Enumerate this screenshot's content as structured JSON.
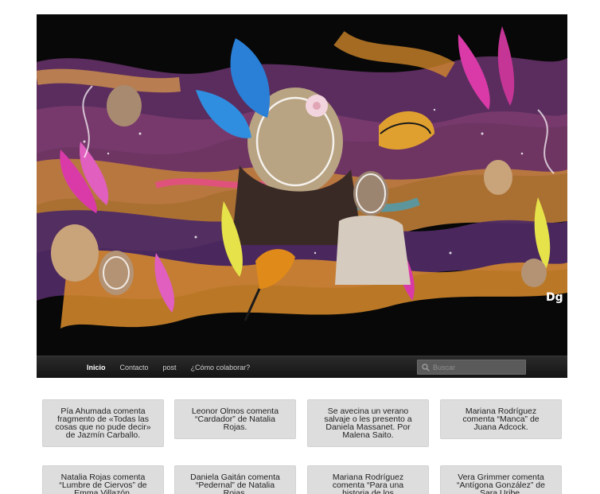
{
  "nav": {
    "items": [
      "Inicio",
      "Contacto",
      "post",
      "¿Cómo colaborar?"
    ],
    "active_index": 0
  },
  "search": {
    "placeholder": "Buscar",
    "value": ""
  },
  "header_art": {
    "signature": "Dg"
  },
  "comments": [
    "Pía Ahumada comenta fragmento de «Todas las cosas que no pude decir» de Jazmín Carballo.",
    "Leonor Olmos comenta “Cardador” de Natalia Rojas.",
    "Se avecina un verano salvaje o les presento a Daniela Massanet. Por Malena Saito.",
    "Mariana Rodríguez comenta “Manca” de Juana Adcock.",
    "Natalia Rojas comenta “Lumbre de Ciervos” de Emma Villazón.",
    "Daniela Gaitán comenta “Pedernal” de Natalia Rojas.",
    "Mariana Rodríguez comenta “Para una historia de los",
    "Vera Grimmer comenta “Antígona González” de Sara Uribe."
  ],
  "colors": {
    "nav_bg": "#1e1e1e",
    "card_bg": "#dddddd",
    "art_bg": "#0a0a0a"
  }
}
